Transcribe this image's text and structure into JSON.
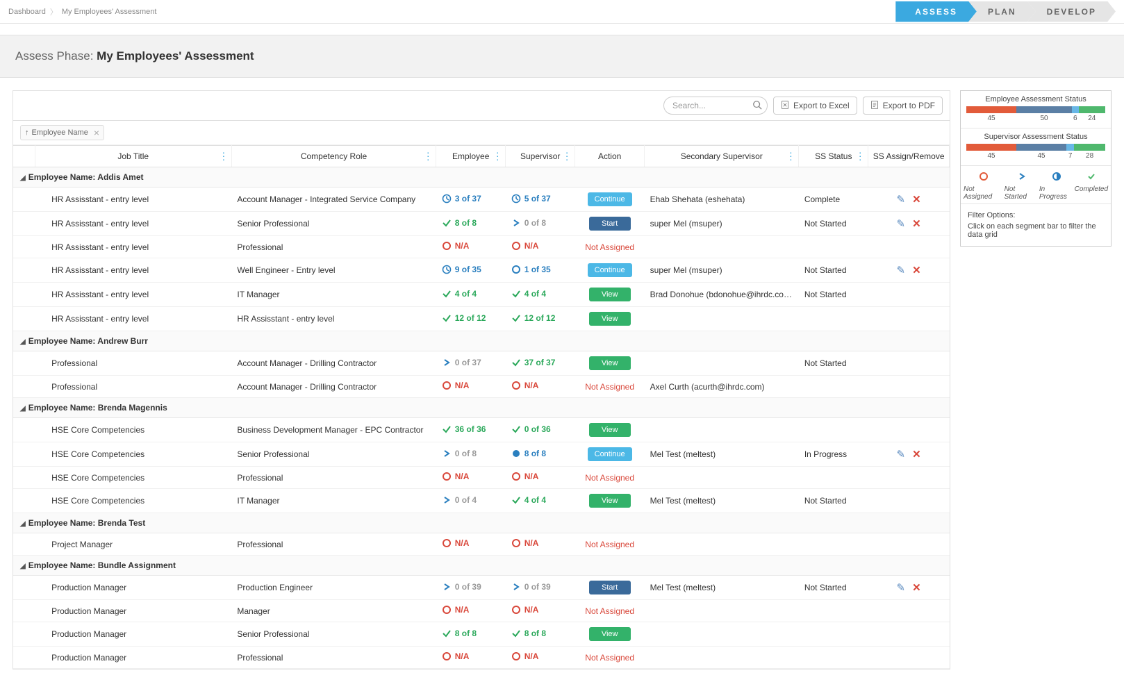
{
  "breadcrumb": {
    "dashboard": "Dashboard",
    "current": "My Employees' Assessment"
  },
  "phases": {
    "assess": "ASSESS",
    "plan": "PLAN",
    "develop": "DEVELOP"
  },
  "pageTitle": {
    "prefix": "Assess Phase: ",
    "name": "My Employees' Assessment"
  },
  "toolbar": {
    "searchPlaceholder": "Search...",
    "exportExcel": "Export to Excel",
    "exportPdf": "Export to PDF"
  },
  "groupChip": {
    "label": "Employee Name"
  },
  "columns": {
    "jobTitle": "Job Title",
    "competencyRole": "Competency Role",
    "employee": "Employee",
    "supervisor": "Supervisor",
    "action": "Action",
    "secondarySupervisor": "Secondary Supervisor",
    "ssStatus": "SS Status",
    "ssAssign": "SS Assign/Remove"
  },
  "groups": [
    {
      "label": "Employee Name: Addis Amet",
      "rows": [
        {
          "jobTitle": "HR Assisstant - entry level",
          "role": "Account Manager - Integrated Service Company",
          "emp": {
            "icon": "clock-blue",
            "text": "3 of 37",
            "cls": "txt-blue"
          },
          "sup": {
            "icon": "clock-blue",
            "text": "5 of 37",
            "cls": "txt-blue"
          },
          "action": {
            "type": "continue",
            "label": "Continue"
          },
          "ss": "Ehab Shehata (eshehata)",
          "ssStatus": "Complete",
          "assign": true
        },
        {
          "jobTitle": "HR Assisstant - entry level",
          "role": "Senior Professional",
          "emp": {
            "icon": "check-green",
            "text": "8 of 8",
            "cls": "txt-green"
          },
          "sup": {
            "icon": "chev-blue",
            "text": "0 of 8",
            "cls": "txt-grey"
          },
          "action": {
            "type": "start",
            "label": "Start"
          },
          "ss": "super Mel (msuper)",
          "ssStatus": "Not Started",
          "assign": true
        },
        {
          "jobTitle": "HR Assisstant - entry level",
          "role": "Professional",
          "emp": {
            "icon": "circle-red",
            "text": "N/A",
            "cls": "txt-red"
          },
          "sup": {
            "icon": "circle-red",
            "text": "N/A",
            "cls": "txt-red"
          },
          "action": {
            "type": "text",
            "label": "Not Assigned"
          },
          "ss": "",
          "ssStatus": "",
          "assign": false
        },
        {
          "jobTitle": "HR Assisstant - entry level",
          "role": "Well Engineer - Entry level",
          "emp": {
            "icon": "clock-blue",
            "text": "9 of 35",
            "cls": "txt-blue"
          },
          "sup": {
            "icon": "circle-blue",
            "text": "1 of 35",
            "cls": "txt-blue"
          },
          "action": {
            "type": "continue",
            "label": "Continue"
          },
          "ss": "super Mel (msuper)",
          "ssStatus": "Not Started",
          "assign": true
        },
        {
          "jobTitle": "HR Assisstant - entry level",
          "role": "IT Manager",
          "emp": {
            "icon": "check-green",
            "text": "4 of 4",
            "cls": "txt-green"
          },
          "sup": {
            "icon": "check-green",
            "text": "4 of 4",
            "cls": "txt-green"
          },
          "action": {
            "type": "view",
            "label": "View"
          },
          "ss": "Brad Donohue (bdonohue@ihrdc.com)",
          "ssStatus": "Not Started",
          "assign": false
        },
        {
          "jobTitle": "HR Assisstant - entry level",
          "role": "HR Assisstant - entry level",
          "emp": {
            "icon": "check-green",
            "text": "12 of 12",
            "cls": "txt-green"
          },
          "sup": {
            "icon": "check-green",
            "text": "12 of 12",
            "cls": "txt-green"
          },
          "action": {
            "type": "view",
            "label": "View"
          },
          "ss": "",
          "ssStatus": "",
          "assign": false
        }
      ]
    },
    {
      "label": "Employee Name: Andrew Burr",
      "rows": [
        {
          "jobTitle": "Professional",
          "role": "Account Manager - Drilling Contractor",
          "emp": {
            "icon": "chev-blue",
            "text": "0 of 37",
            "cls": "txt-grey"
          },
          "sup": {
            "icon": "check-green",
            "text": "37 of 37",
            "cls": "txt-green"
          },
          "action": {
            "type": "view",
            "label": "View"
          },
          "ss": "",
          "ssStatus": "Not Started",
          "assign": false
        },
        {
          "jobTitle": "Professional",
          "role": "Account Manager - Drilling Contractor",
          "emp": {
            "icon": "circle-red",
            "text": "N/A",
            "cls": "txt-red"
          },
          "sup": {
            "icon": "circle-red",
            "text": "N/A",
            "cls": "txt-red"
          },
          "action": {
            "type": "text",
            "label": "Not Assigned"
          },
          "ss": "Axel Curth (acurth@ihrdc.com)",
          "ssStatus": "",
          "assign": false
        }
      ]
    },
    {
      "label": "Employee Name: Brenda Magennis",
      "rows": [
        {
          "jobTitle": "HSE Core Competencies",
          "role": "Business Development Manager - EPC Contractor",
          "emp": {
            "icon": "check-green",
            "text": "36 of 36",
            "cls": "txt-green"
          },
          "sup": {
            "icon": "check-green",
            "text": "0 of 36",
            "cls": "txt-green"
          },
          "action": {
            "type": "view",
            "label": "View"
          },
          "ss": "",
          "ssStatus": "",
          "assign": false
        },
        {
          "jobTitle": "HSE Core Competencies",
          "role": "Senior Professional",
          "emp": {
            "icon": "chev-blue",
            "text": "0 of 8",
            "cls": "txt-grey"
          },
          "sup": {
            "icon": "dot-blue",
            "text": "8 of 8",
            "cls": "txt-blue"
          },
          "action": {
            "type": "continue",
            "label": "Continue"
          },
          "ss": "Mel Test (meltest)",
          "ssStatus": "In Progress",
          "assign": true
        },
        {
          "jobTitle": "HSE Core Competencies",
          "role": "Professional",
          "emp": {
            "icon": "circle-red",
            "text": "N/A",
            "cls": "txt-red"
          },
          "sup": {
            "icon": "circle-red",
            "text": "N/A",
            "cls": "txt-red"
          },
          "action": {
            "type": "text",
            "label": "Not Assigned"
          },
          "ss": "",
          "ssStatus": "",
          "assign": false
        },
        {
          "jobTitle": "HSE Core Competencies",
          "role": "IT Manager",
          "emp": {
            "icon": "chev-blue",
            "text": "0 of 4",
            "cls": "txt-grey"
          },
          "sup": {
            "icon": "check-green",
            "text": "4 of 4",
            "cls": "txt-green"
          },
          "action": {
            "type": "view",
            "label": "View"
          },
          "ss": "Mel Test (meltest)",
          "ssStatus": "Not Started",
          "assign": false
        }
      ]
    },
    {
      "label": "Employee Name: Brenda Test",
      "rows": [
        {
          "jobTitle": "Project Manager",
          "role": "Professional",
          "emp": {
            "icon": "circle-red",
            "text": "N/A",
            "cls": "txt-red"
          },
          "sup": {
            "icon": "circle-red",
            "text": "N/A",
            "cls": "txt-red"
          },
          "action": {
            "type": "text",
            "label": "Not Assigned"
          },
          "ss": "",
          "ssStatus": "",
          "assign": false
        }
      ]
    },
    {
      "label": "Employee Name: Bundle Assignment",
      "rows": [
        {
          "jobTitle": "Production Manager",
          "role": "Production Engineer",
          "emp": {
            "icon": "chev-blue",
            "text": "0 of 39",
            "cls": "txt-grey"
          },
          "sup": {
            "icon": "chev-blue",
            "text": "0 of 39",
            "cls": "txt-grey"
          },
          "action": {
            "type": "start",
            "label": "Start"
          },
          "ss": "Mel Test (meltest)",
          "ssStatus": "Not Started",
          "assign": true
        },
        {
          "jobTitle": "Production Manager",
          "role": "Manager",
          "emp": {
            "icon": "circle-red",
            "text": "N/A",
            "cls": "txt-red"
          },
          "sup": {
            "icon": "circle-red",
            "text": "N/A",
            "cls": "txt-red"
          },
          "action": {
            "type": "text",
            "label": "Not Assigned"
          },
          "ss": "",
          "ssStatus": "",
          "assign": false
        },
        {
          "jobTitle": "Production Manager",
          "role": "Senior Professional",
          "emp": {
            "icon": "check-green",
            "text": "8 of 8",
            "cls": "txt-green"
          },
          "sup": {
            "icon": "check-green",
            "text": "8 of 8",
            "cls": "txt-green"
          },
          "action": {
            "type": "view",
            "label": "View"
          },
          "ss": "",
          "ssStatus": "",
          "assign": false
        },
        {
          "jobTitle": "Production Manager",
          "role": "Professional",
          "emp": {
            "icon": "circle-red",
            "text": "N/A",
            "cls": "txt-red"
          },
          "sup": {
            "icon": "circle-red",
            "text": "N/A",
            "cls": "txt-red"
          },
          "action": {
            "type": "text",
            "label": "Not Assigned"
          },
          "ss": "",
          "ssStatus": "",
          "assign": false
        }
      ]
    }
  ],
  "sidePanel": {
    "empTitle": "Employee Assessment Status",
    "supTitle": "Supervisor Assessment Status",
    "empBar": [
      {
        "cls": "seg-red",
        "val": 45
      },
      {
        "cls": "seg-blue",
        "val": 50
      },
      {
        "cls": "seg-lblue",
        "val": 6
      },
      {
        "cls": "seg-green",
        "val": 24
      }
    ],
    "supBar": [
      {
        "cls": "seg-red",
        "val": 45
      },
      {
        "cls": "seg-blue",
        "val": 45
      },
      {
        "cls": "seg-lblue",
        "val": 7
      },
      {
        "cls": "seg-green",
        "val": 28
      }
    ],
    "legend": {
      "notAssigned": "Not Assigned",
      "notStarted": "Not Started",
      "inProgress": "In Progress",
      "completed": "Completed"
    },
    "filterTitle": "Filter Options:",
    "filterText": "Click on each segment bar to filter the data grid"
  },
  "chart_data": [
    {
      "type": "bar",
      "title": "Employee Assessment Status",
      "categories": [
        "Not Assigned",
        "Not Started",
        "In Progress",
        "Completed"
      ],
      "values": [
        45,
        50,
        6,
        24
      ]
    },
    {
      "type": "bar",
      "title": "Supervisor Assessment Status",
      "categories": [
        "Not Assigned",
        "Not Started",
        "In Progress",
        "Completed"
      ],
      "values": [
        45,
        45,
        7,
        28
      ]
    }
  ]
}
